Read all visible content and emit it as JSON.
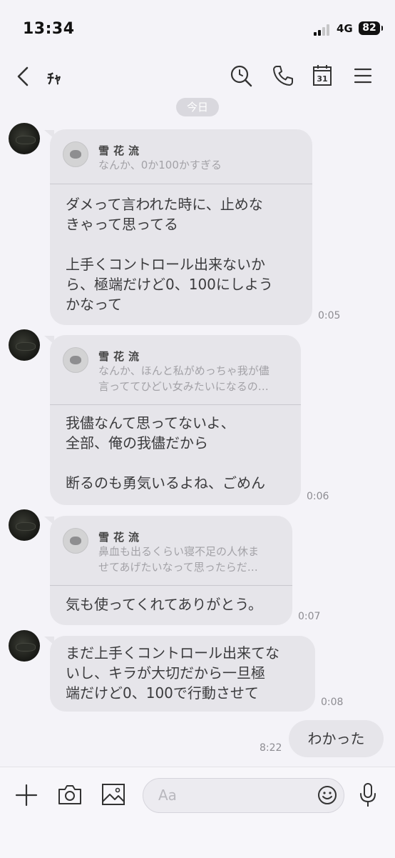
{
  "status_bar": {
    "time": "13:34",
    "network": "4G",
    "battery": "82"
  },
  "header": {
    "title": "ﾁｬ",
    "calendar_day": "31"
  },
  "date_divider": "今日",
  "messages": [
    {
      "quote": {
        "name": "雪花流",
        "text_lines": [
          "なんか、0か100かすぎる"
        ]
      },
      "text": "ダメって言われた時に、止めな\nきゃって思ってる\n\n上手くコントロール出来ないか\nら、極端だけど0、100にしよう\nかなって",
      "time": "0:05"
    },
    {
      "quote": {
        "name": "雪花流",
        "text_lines": [
          "なんか、ほんと私がめっちゃ我が儘",
          "言っててひどい女みたいになるの…"
        ]
      },
      "text": "我儘なんて思ってないよ、\n全部、俺の我儘だから\n\n断るのも勇気いるよね、ごめん",
      "time": "0:06"
    },
    {
      "quote": {
        "name": "雪花流",
        "text_lines": [
          "鼻血も出るくらい寝不足の人休ま",
          "せてあげたいなって思ったらだ…"
        ]
      },
      "text": "気も使ってくれてありがとう。",
      "time": "0:07"
    },
    {
      "text": "まだ上手くコントロール出来てな\nいし、キラが大切だから一旦極\n端だけど0、100で行動させて",
      "time": "0:08"
    }
  ],
  "my_message": {
    "text": "わかった",
    "time": "8:22"
  },
  "composer": {
    "placeholder": "Aa"
  }
}
